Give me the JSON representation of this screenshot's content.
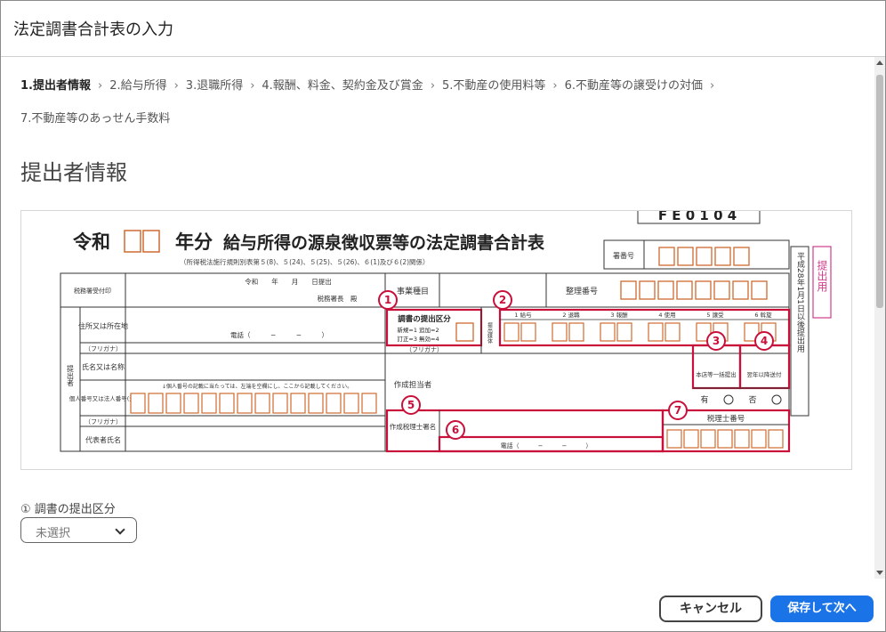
{
  "dialog": {
    "title": "法定調書合計表の入力"
  },
  "steps": [
    {
      "label": "1.提出者情報",
      "active": true
    },
    {
      "label": "2.給与所得",
      "active": false
    },
    {
      "label": "3.退職所得",
      "active": false
    },
    {
      "label": "4.報酬、料金、契約金及び賞金",
      "active": false
    },
    {
      "label": "5.不動産の使用料等",
      "active": false
    },
    {
      "label": "6.不動産等の譲受けの対価",
      "active": false
    },
    {
      "label": "7.不動産等のあっせん手数料",
      "active": false
    }
  ],
  "section": {
    "title": "提出者情報"
  },
  "form_image": {
    "code": "F E 0 1 0 4",
    "era": "令和",
    "year_suffix": "年分",
    "heading": "給与所得の源泉徴収票等の法定調書合計表",
    "subheading": "（所得税法施行規則別表第５(8)、５(24)、５(25)、５(26)、６(1)及び６(2)関係）",
    "office_no": "署番号",
    "management_no": "整理番号",
    "business_type": "事業種目",
    "tax_office_stamp": "税務署受付印",
    "date_line": "令和　　年　　月　　日提出",
    "director": "税務署長　殿",
    "address": "住所又は所在地",
    "phone": "電話（　　　−　　　−　　　）",
    "furigana": "（フリガナ）",
    "name": "氏名又は名称",
    "personal_no": "個人番号又は法人番号(注)",
    "personal_note": "↓個人番号の記載に当たっては、左端を空欄にし、ここから記載してください。",
    "rep": "代表者氏名",
    "submitter": "提出者",
    "doc_type": "調書の提出区分",
    "doc_note1": "新規=1 追加=2",
    "doc_note2": "訂正=3 無効=4",
    "media": "提出媒体",
    "media_cols": [
      "1 給与",
      "2 退職",
      "3 報酬",
      "4 使用",
      "5 譲受",
      "6 斡旋"
    ],
    "head_office": "本店等一括提出",
    "next_year": "翌年以降送付",
    "yes": "有",
    "no": "否",
    "preparer": "作成担当者",
    "tax_accountant": "作成税理士署名",
    "tax_accountant_no": "税理士番号",
    "side_text": "平成28年1月1日以後提出用",
    "teishutsu": "提出用",
    "markers": [
      "1",
      "2",
      "3",
      "4",
      "5",
      "6",
      "7"
    ]
  },
  "field": {
    "label": "①  調書の提出区分",
    "select_value": "未選択"
  },
  "footer": {
    "cancel": "キャンセル",
    "save": "保存して次へ"
  }
}
